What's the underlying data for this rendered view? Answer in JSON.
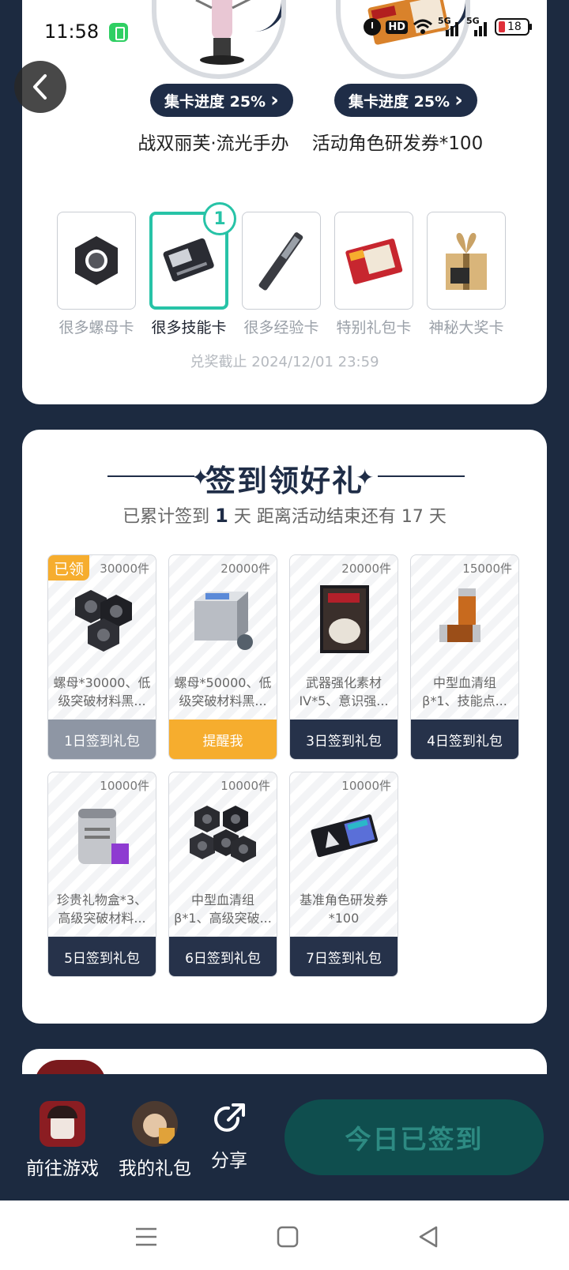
{
  "status_bar": {
    "time": "11:58",
    "network_hd": "HD",
    "network_5g_a": "5G",
    "network_5g_b": "5G",
    "battery": "18"
  },
  "prizes": [
    {
      "progress": "集卡进度 25%",
      "chevron": "›",
      "name": "战双丽芙·流光手办"
    },
    {
      "progress": "集卡进度 25%",
      "chevron": "›",
      "name": "活动角色研发券*100"
    }
  ],
  "rewards": [
    {
      "label": "很多螺母卡",
      "selected": false
    },
    {
      "label": "很多技能卡",
      "selected": true,
      "badge": "1"
    },
    {
      "label": "很多经验卡",
      "selected": false
    },
    {
      "label": "特别礼包卡",
      "selected": false
    },
    {
      "label": "神秘大奖卡",
      "selected": false
    }
  ],
  "deadline": "兑奖截止 2024/12/01 23:59",
  "signin": {
    "title": "签到领好礼",
    "sub_prefix": "已累计签到 ",
    "sub_days": "1",
    "sub_suffix": " 天  距离活动结束还有 17 天",
    "gifts": [
      {
        "stock": "30000件",
        "claimed": "已领",
        "desc": "螺母*30000、低级突破材料黑...",
        "button": "1日签到礼包",
        "state": "claimed"
      },
      {
        "stock": "20000件",
        "desc": "螺母*50000、低级突破材料黑...",
        "button": "提醒我",
        "state": "remind"
      },
      {
        "stock": "20000件",
        "desc": "武器强化素材IV*5、意识强...",
        "button": "3日签到礼包",
        "state": "normal"
      },
      {
        "stock": "15000件",
        "desc": "中型血清组β*1、技能点...",
        "button": "4日签到礼包",
        "state": "normal"
      },
      {
        "stock": "10000件",
        "desc": "珍贵礼物盒*3、高级突破材料...",
        "button": "5日签到礼包",
        "state": "normal"
      },
      {
        "stock": "10000件",
        "desc": "中型血清组β*1、高级突破...",
        "button": "6日签到礼包",
        "state": "normal"
      },
      {
        "stock": "10000件",
        "desc": "基准角色研发券*100",
        "button": "7日签到礼包",
        "state": "normal"
      }
    ]
  },
  "bottom_bar": {
    "go_game": "前往游戏",
    "my_gifts": "我的礼包",
    "share": "分享",
    "signed_today": "今日已签到"
  },
  "colors": {
    "accent": "#27c3a7",
    "navy": "#1f2d47",
    "orange": "#f6ad2e",
    "page_bg": "#1c2a40"
  }
}
